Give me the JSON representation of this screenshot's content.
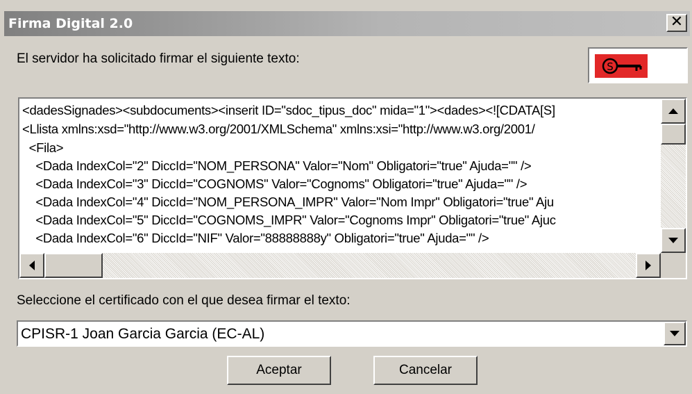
{
  "window": {
    "title": "Firma Digital 2.0",
    "close_symbol": "✕"
  },
  "prompt_label": "El servidor ha solicitado firmar el siguiente texto:",
  "key_icon": "key-icon",
  "text_lines": [
    "<dadesSignades><subdocuments><inserit ID=\"sdoc_tipus_doc\" mida=\"1\"><dades><![CDATA[S]",
    "<Llista xmlns:xsd=\"http://www.w3.org/2001/XMLSchema\" xmlns:xsi=\"http://www.w3.org/2001/",
    "  <Fila>",
    "    <Dada IndexCol=\"2\" DiccId=\"NOM_PERSONA\" Valor=\"Nom\" Obligatori=\"true\" Ajuda=\"\" />",
    "    <Dada IndexCol=\"3\" DiccId=\"COGNOMS\" Valor=\"Cognoms\" Obligatori=\"true\" Ajuda=\"\" />",
    "    <Dada IndexCol=\"4\" DiccId=\"NOM_PERSONA_IMPR\" Valor=\"Nom Impr\" Obligatori=\"true\" Aju",
    "    <Dada IndexCol=\"5\" DiccId=\"COGNOMS_IMPR\" Valor=\"Cognoms Impr\" Obligatori=\"true\" Ajuc",
    "    <Dada IndexCol=\"6\" DiccId=\"NIF\" Valor=\"88888888y\" Obligatori=\"true\" Ajuda=\"\" />"
  ],
  "certificate_label": "Seleccione el certificado con el que desea  firmar el texto:",
  "certificate_select": {
    "value": "CPISR-1 Joan Garcia Garcia (EC-AL)"
  },
  "buttons": {
    "accept": "Aceptar",
    "cancel": "Cancelar"
  },
  "colors": {
    "dialog_bg": "#d4d0c8",
    "key_red": "#e22828"
  }
}
